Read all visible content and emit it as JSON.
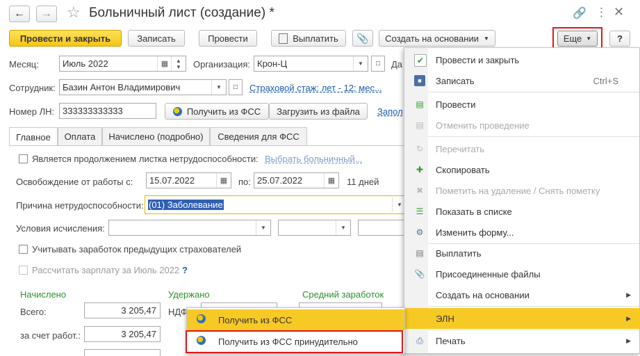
{
  "window": {
    "title": "Больничный лист (создание) *"
  },
  "toolbar": {
    "post_close": "Провести и закрыть",
    "save": "Записать",
    "post": "Провести",
    "pay": "Выплатить",
    "create_based": "Создать на основании",
    "more": "Еще",
    "help": "?"
  },
  "form": {
    "month_label": "Месяц:",
    "month_value": "Июль 2022",
    "org_label": "Организация:",
    "org_value": "Крон-Ц",
    "date_label_partial": "Да",
    "employee_label": "Сотрудник:",
    "employee_value": "Базин Антон Владимирович",
    "insurance_link": "Страховой стаж: лет - 12; мес...",
    "ln_label": "Номер ЛН:",
    "ln_value": "333333333333",
    "get_fss": "Получить из ФСС",
    "load_file": "Загрузить из файла",
    "fill_link_partial": "Запол"
  },
  "tabs": [
    "Главное",
    "Оплата",
    "Начислено (подробно)",
    "Сведения для ФСС"
  ],
  "main": {
    "continuation_label": "Является продолжением листка нетрудоспособности:",
    "choose_sick_link": "Выбрать больничный...",
    "release_label": "Освобождение от работы с:",
    "date_from": "15.07.2022",
    "to_label": "по:",
    "date_to": "25.07.2022",
    "days": "11 дней",
    "reason_label": "Причина нетрудоспособности:",
    "reason_value": "(01) Заболевание",
    "conditions_label": "Условия исчисления:",
    "prev_insurers_label": "Учитывать заработок предыдущих страхователей",
    "calc_salary_label": "Рассчитать зарплату за Июль 2022",
    "calc_help": "?",
    "accrued_header": "Начислено",
    "withheld_header": "Удержано",
    "avg_header": "Средний заработок",
    "total_label": "Всего:",
    "total_value": "3 205,47",
    "employer_label": "за счет работ.:",
    "employer_value": "3 205,47",
    "ndfl_label_partial": "НДФ"
  },
  "menu": {
    "items": [
      {
        "label": "Провести и закрыть",
        "icon": "post-close-icon"
      },
      {
        "label": "Записать",
        "shortcut": "Ctrl+S",
        "icon": "save-icon"
      },
      {
        "label": "Провести",
        "icon": "post-icon"
      },
      {
        "label": "Отменить проведение",
        "icon": "unpost-icon"
      },
      {
        "label": "Перечитать",
        "icon": "reread-icon"
      },
      {
        "label": "Скопировать",
        "icon": "copy-icon"
      },
      {
        "label": "Пометить на удаление / Снять пометку",
        "icon": "delete-mark-icon"
      },
      {
        "label": "Показать в списке",
        "icon": "show-list-icon"
      },
      {
        "label": "Изменить форму...",
        "icon": "change-form-icon"
      },
      {
        "label": "Выплатить",
        "icon": "pay-icon"
      },
      {
        "label": "Присоединенные файлы",
        "icon": "paperclip-icon"
      },
      {
        "label": "Создать на основании",
        "icon": "create-based-icon"
      },
      {
        "label": "ЭЛН",
        "icon": "eln-icon"
      },
      {
        "label": "Печать",
        "icon": "print-icon"
      }
    ]
  },
  "submenu": {
    "items": [
      {
        "label": "Получить из ФСС"
      },
      {
        "label": "Получить из ФСС принудительно"
      }
    ]
  },
  "colors": {
    "accent_yellow": "#f7c924",
    "highlight_red": "#e0151b",
    "link_blue": "#1a5cad",
    "header_green": "#2d8f2d"
  }
}
